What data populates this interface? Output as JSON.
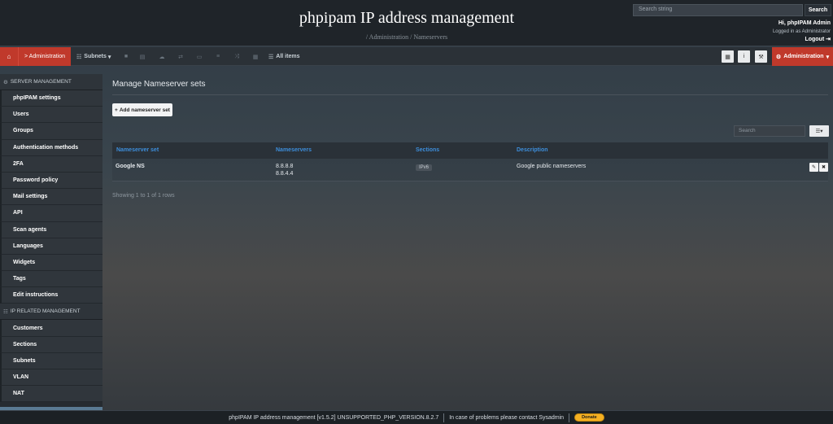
{
  "header": {
    "title": "phpipam IP address management",
    "breadcrumb": "/ Administration / Nameservers",
    "search_placeholder": "Search string",
    "search_button": "Search",
    "greeting": "Hi, phpIPAM Admin",
    "logged_in_as": "Logged in as  Administrator",
    "logout": "Logout"
  },
  "navbar": {
    "home_icon": "home-icon",
    "admin_crumb": "> Administration",
    "subnets": "Subnets",
    "all_items": "All items",
    "admin_menu": "Administration"
  },
  "sidebar": {
    "section1": "SERVER MANAGEMENT",
    "items1": [
      "phpIPAM settings",
      "Users",
      "Groups",
      "Authentication methods",
      "2FA",
      "Password policy",
      "Mail settings",
      "API",
      "Scan agents",
      "Languages",
      "Widgets",
      "Tags",
      "Edit instructions"
    ],
    "section2": "IP RELATED MANAGEMENT",
    "items2": [
      "Customers",
      "Sections",
      "Subnets",
      "VLAN",
      "NAT"
    ]
  },
  "main": {
    "heading": "Manage Nameserver sets",
    "add_button": "Add nameserver set",
    "table_search_placeholder": "Search",
    "columns": [
      "Nameserver set",
      "Nameservers",
      "Sections",
      "Description"
    ],
    "rows": [
      {
        "name": "Google NS",
        "ns1": "8.8.8.8",
        "ns2": "8.8.4.4",
        "section": "IPv6",
        "description": "Google public nameservers"
      }
    ],
    "showing": "Showing 1 to 1 of 1 rows"
  },
  "footer": {
    "version": "phpIPAM IP address management [v1.5.2] UNSUPPORTED_PHP_VERSION.8.2.7",
    "problems": "In case of problems please contact Sysadmin",
    "donate": "Donate"
  },
  "colors": {
    "accent_red": "#c0392b",
    "link_blue": "#3d8edb"
  }
}
